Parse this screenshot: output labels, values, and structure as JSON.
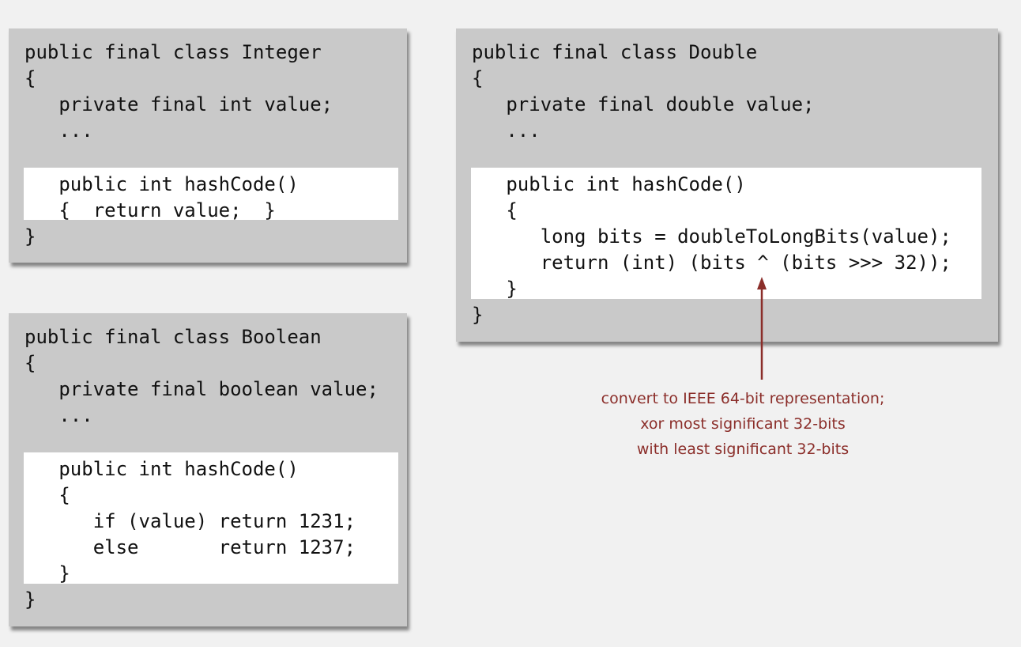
{
  "panels": {
    "integer": {
      "lines": [
        "public final class Integer",
        "{",
        "   private final int value;",
        "   ...",
        "",
        "   public int hashCode()",
        "   {  return value;  }",
        "}"
      ]
    },
    "double": {
      "lines": [
        "public final class Double",
        "{",
        "   private final double value;",
        "   ...",
        "",
        "   public int hashCode()",
        "   {",
        "      long bits = doubleToLongBits(value);",
        "      return (int) (bits ^ (bits >>> 32));",
        "   }",
        "}"
      ]
    },
    "boolean": {
      "lines": [
        "public final class Boolean",
        "{",
        "   private final boolean value;",
        "   ...",
        "",
        "   public int hashCode()",
        "   {",
        "      if (value) return 1231;",
        "      else       return 1237;",
        "   }",
        "}"
      ]
    }
  },
  "annotation": {
    "lines": [
      "convert to IEEE 64-bit representation;",
      "xor most significant 32-bits",
      "with least significant 32-bits"
    ]
  },
  "colors": {
    "panel": "#c9c9c9",
    "highlight": "#ffffff",
    "annotation": "#8b2e2a",
    "background": "#f1f1f1"
  }
}
